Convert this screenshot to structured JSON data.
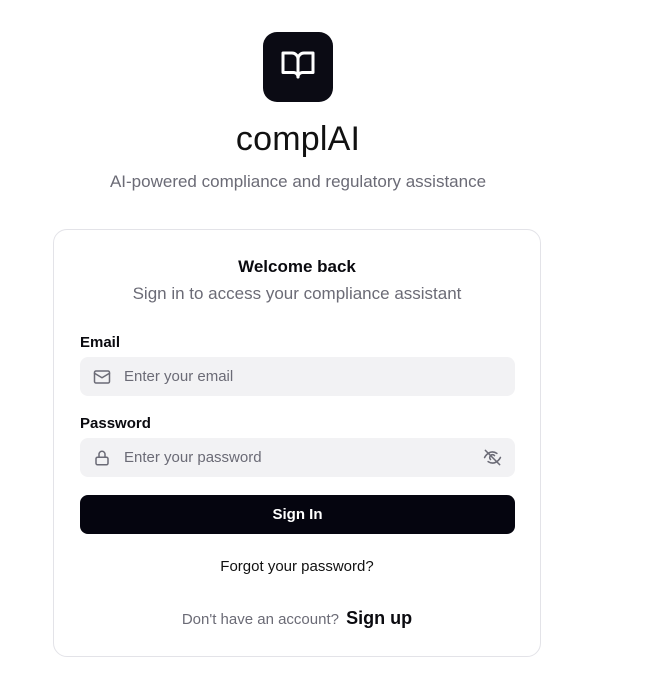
{
  "header": {
    "logo_icon": "book-open-icon",
    "app_name": "complAI",
    "tagline": "AI-powered compliance and regulatory assistance"
  },
  "card": {
    "title": "Welcome back",
    "subtitle": "Sign in to access your compliance assistant",
    "email": {
      "label": "Email",
      "placeholder": "Enter your email",
      "value": "",
      "icon": "mail-icon"
    },
    "password": {
      "label": "Password",
      "placeholder": "Enter your password",
      "value": "",
      "icon": "lock-icon",
      "toggle_icon": "eye-off-icon"
    },
    "sign_in_label": "Sign In",
    "forgot_label": "Forgot your password?",
    "signup_prompt": "Don't have an account?",
    "signup_label": "Sign up"
  },
  "colors": {
    "primary": "#05050f",
    "muted_text": "#6b6b76",
    "input_bg": "#f2f2f4",
    "border": "#e3e3e8"
  }
}
